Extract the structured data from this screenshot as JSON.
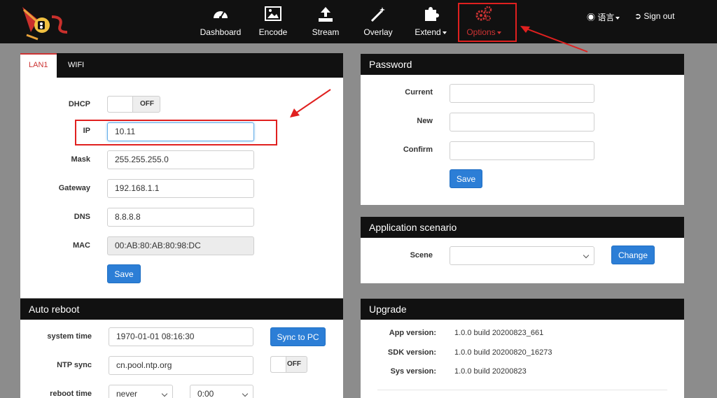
{
  "nav": {
    "items": [
      {
        "label": "Dashboard"
      },
      {
        "label": "Encode"
      },
      {
        "label": "Stream"
      },
      {
        "label": "Overlay"
      },
      {
        "label": "Extend"
      },
      {
        "label": "Options"
      }
    ],
    "language": "语言",
    "sign_out": "Sign out"
  },
  "network": {
    "tabs": [
      "LAN1",
      "WIFI"
    ],
    "dhcp_label": "DHCP",
    "dhcp_state": "OFF",
    "ip_label": "IP",
    "ip_value": "10.11",
    "mask_label": "Mask",
    "mask_value": "255.255.255.0",
    "gateway_label": "Gateway",
    "gateway_value": "192.168.1.1",
    "dns_label": "DNS",
    "dns_value": "8.8.8.8",
    "mac_label": "MAC",
    "mac_value": "00:AB:80:AB:80:98:DC",
    "save": "Save"
  },
  "password": {
    "title": "Password",
    "current_label": "Current",
    "new_label": "New",
    "confirm_label": "Confirm",
    "save": "Save"
  },
  "scenario": {
    "title": "Application scenario",
    "scene_label": "Scene",
    "scene_value": "",
    "change": "Change"
  },
  "auto_reboot": {
    "title": "Auto reboot",
    "system_time_label": "system time",
    "system_time_value": "1970-01-01 08:16:30",
    "sync": "Sync to PC",
    "ntp_label": "NTP sync",
    "ntp_value": "cn.pool.ntp.org",
    "ntp_state": "OFF",
    "reboot_label": "reboot time",
    "reboot_day": "never",
    "reboot_time": "0:00"
  },
  "upgrade": {
    "title": "Upgrade",
    "app_label": "App version:",
    "app_value": "1.0.0 build 20200823_661",
    "sdk_label": "SDK version:",
    "sdk_value": "1.0.0 build 20200820_16273",
    "sys_label": "Sys version:",
    "sys_value": "1.0.0 build 20200823"
  },
  "colors": {
    "accent": "#2c7ed6",
    "highlight": "#e0201f",
    "active_nav": "#cc3333"
  }
}
